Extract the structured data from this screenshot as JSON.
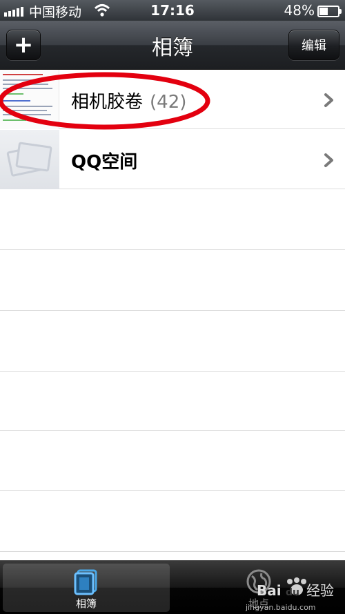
{
  "status_bar": {
    "carrier": "中国移动",
    "time": "17:16",
    "battery_percent_label": "48%",
    "battery_level": 0.48,
    "signal_bars": 5,
    "icons": [
      "signal-icon",
      "wifi-icon",
      "battery-icon"
    ]
  },
  "nav": {
    "title": "相簿",
    "add_label": "+",
    "edit_label": "编辑"
  },
  "albums": [
    {
      "name": "相机胶卷",
      "count": "(42)",
      "thumbnail": "document-screenshot-thumbnail",
      "highlighted": true
    },
    {
      "name": "QQ空间",
      "count": "",
      "thumbnail": "placeholder-photos-thumbnail",
      "highlighted": false
    }
  ],
  "tabs": [
    {
      "label": "相簿",
      "icon": "albums-icon",
      "selected": true
    },
    {
      "label": "地点",
      "icon": "places-globe-icon",
      "selected": false
    }
  ],
  "watermark": {
    "text": "jingyan.baidu.com",
    "logo_text": "Bai du 经验"
  },
  "colors": {
    "annotation": "#e3000f",
    "tab_selected": "#4aa8e8",
    "nav_bar": "#2b2e33"
  }
}
